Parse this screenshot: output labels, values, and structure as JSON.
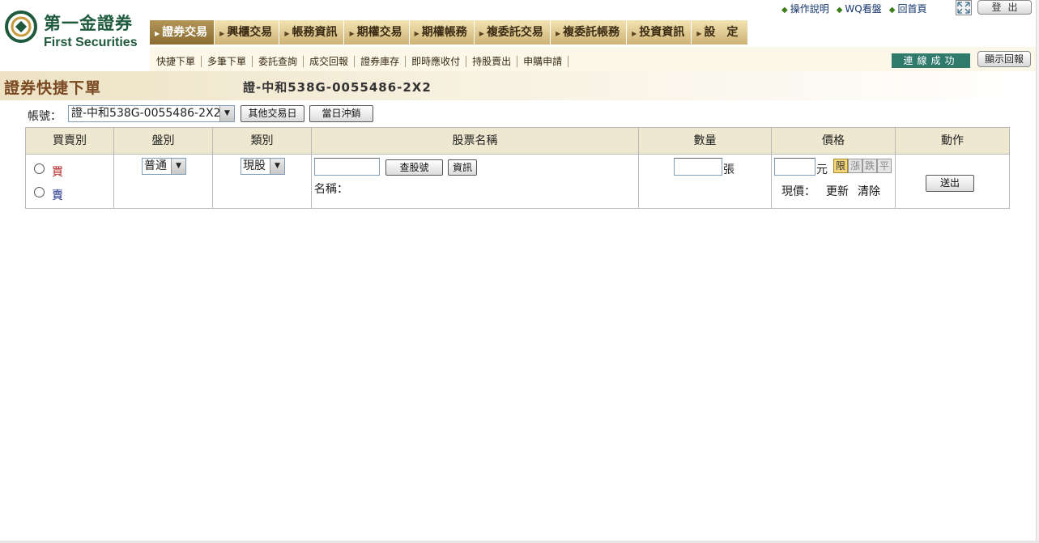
{
  "brand": {
    "name_zh": "第一金證券",
    "name_en": "First Securities",
    "color": "#1f5a3c"
  },
  "top_links": [
    {
      "label": "操作說明",
      "icon": "diamond-icon"
    },
    {
      "label": "WQ看盤",
      "icon": "diamond-icon"
    },
    {
      "label": "回首頁",
      "icon": "diamond-icon"
    }
  ],
  "expand_icon": "expand-icon",
  "logout_label": "登出",
  "main_nav": [
    {
      "label": "證券交易",
      "active": true
    },
    {
      "label": "興櫃交易",
      "active": false
    },
    {
      "label": "帳務資訊",
      "active": false
    },
    {
      "label": "期權交易",
      "active": false
    },
    {
      "label": "期權帳務",
      "active": false
    },
    {
      "label": "複委託交易",
      "active": false
    },
    {
      "label": "複委託帳務",
      "active": false
    },
    {
      "label": "投資資訊",
      "active": false
    },
    {
      "label": "設　定",
      "active": false
    }
  ],
  "sub_nav": [
    "快捷下單",
    "多筆下單",
    "委託查詢",
    "成交回報",
    "證券庫存",
    "即時應收付",
    "持股賣出",
    "申購申請"
  ],
  "connection_status": "連線成功",
  "show_report_label": "顯示回報",
  "page_title": "證券快捷下單",
  "account_title": "證-中和538G-0055486-2X2",
  "account": {
    "label": "帳號：",
    "selected": "證-中和538G-0055486-2X2",
    "other_day_button": "其他交易日",
    "same_day_button": "當日沖銷"
  },
  "order_table": {
    "headers": [
      "買賣別",
      "盤別",
      "類別",
      "股票名稱",
      "數量",
      "價格",
      "動作"
    ],
    "side_options": [
      {
        "label": "買",
        "color": "#b22222"
      },
      {
        "label": "賣",
        "color": "#1a2a8a"
      }
    ],
    "session_selected": "普通",
    "category_selected": "現股",
    "stock_code_value": "",
    "lookup_button": "查股號",
    "info_button": "資訊",
    "name_label": "名稱：",
    "quantity_value": "",
    "quantity_unit": "張",
    "price_value": "",
    "price_unit": "元",
    "price_types": [
      {
        "label": "限",
        "active": true
      },
      {
        "label": "漲",
        "active": false
      },
      {
        "label": "跌",
        "active": false
      },
      {
        "label": "平",
        "active": false
      }
    ],
    "current_price_label": "現價：",
    "refresh_label": "更新",
    "clear_label": "清除",
    "submit_label": "送出"
  }
}
